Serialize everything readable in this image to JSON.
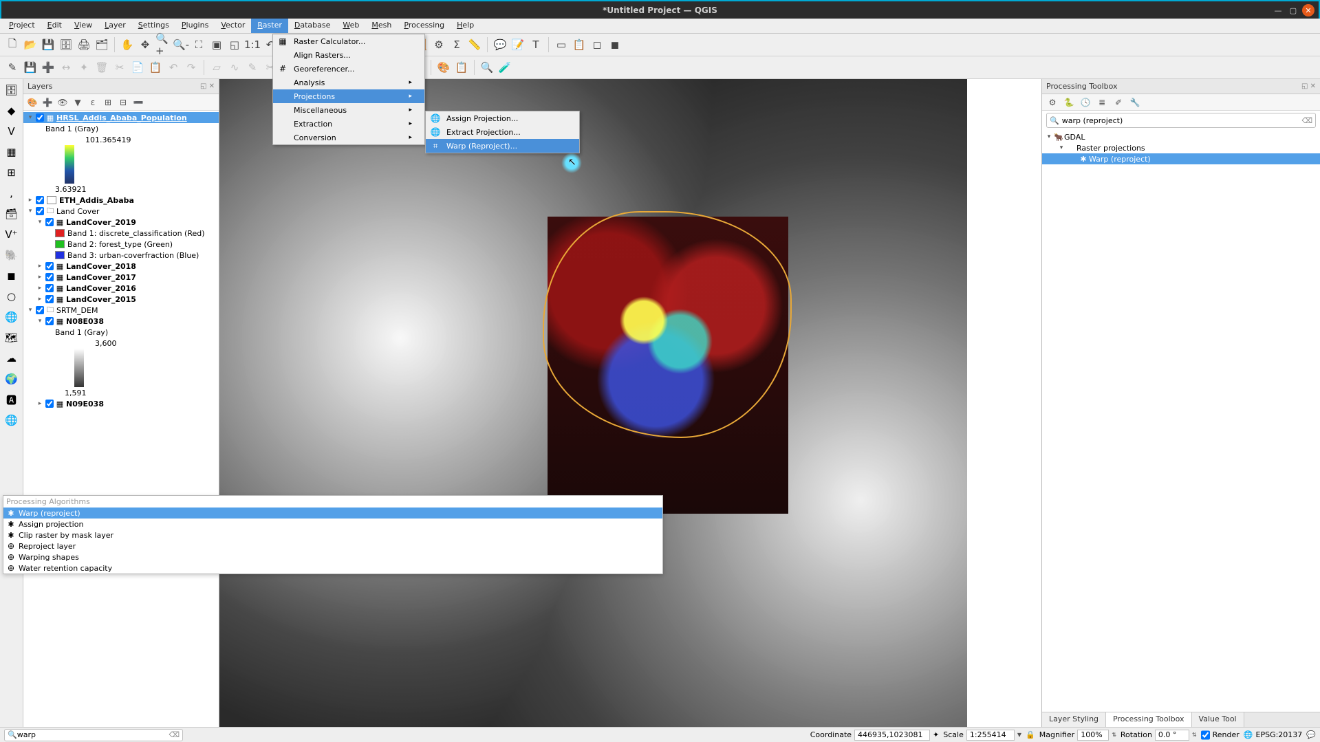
{
  "window": {
    "title": "*Untitled Project — QGIS"
  },
  "menubar": [
    "Project",
    "Edit",
    "View",
    "Layer",
    "Settings",
    "Plugins",
    "Vector",
    "Raster",
    "Database",
    "Web",
    "Mesh",
    "Processing",
    "Help"
  ],
  "menubar_active": "Raster",
  "raster_menu": {
    "items": [
      {
        "label": "Raster Calculator...",
        "icon": "▦"
      },
      {
        "label": "Align Rasters..."
      },
      {
        "label": "Georeferencer...",
        "icon": "#"
      },
      {
        "label": "Analysis",
        "submenu": true
      },
      {
        "label": "Projections",
        "submenu": true,
        "hl": true
      },
      {
        "label": "Miscellaneous",
        "submenu": true
      },
      {
        "label": "Extraction",
        "submenu": true
      },
      {
        "label": "Conversion",
        "submenu": true
      }
    ]
  },
  "proj_submenu": {
    "items": [
      {
        "label": "Assign Projection...",
        "icon": "🌐"
      },
      {
        "label": "Extract Projection...",
        "icon": "🌐"
      },
      {
        "label": "Warp (Reproject)...",
        "icon": "⌗",
        "hl": true
      }
    ]
  },
  "layers_panel": {
    "title": "Layers",
    "tree": [
      {
        "indent": 0,
        "exp": "▾",
        "cb": true,
        "glyph": "▦",
        "label": "HRSL_Addis_Ababa_Population",
        "sel": true,
        "bold": true
      },
      {
        "indent": 1,
        "label": "Band 1 (Gray)"
      },
      {
        "indent": 2,
        "label": "101.365419",
        "gradient": "g1"
      },
      {
        "indent": 2,
        "label": "3.63921"
      },
      {
        "indent": 0,
        "exp": "▸",
        "cb": true,
        "sw": "#ffffff",
        "label": "ETH_Addis_Ababa",
        "bold": true
      },
      {
        "indent": 0,
        "exp": "▾",
        "cb": true,
        "glyph": "🗀",
        "label": "Land Cover"
      },
      {
        "indent": 1,
        "exp": "▾",
        "cb": true,
        "glyph": "▦",
        "label": "LandCover_2019",
        "bold": true
      },
      {
        "indent": 2,
        "sw": "#e02020",
        "label": "Band 1: discrete_classification (Red)"
      },
      {
        "indent": 2,
        "sw": "#20c020",
        "label": "Band 2: forest_type (Green)"
      },
      {
        "indent": 2,
        "sw": "#2030e0",
        "label": "Band 3: urban-coverfraction (Blue)"
      },
      {
        "indent": 1,
        "exp": "▸",
        "cb": true,
        "glyph": "▦",
        "label": "LandCover_2018",
        "bold": true
      },
      {
        "indent": 1,
        "exp": "▸",
        "cb": true,
        "glyph": "▦",
        "label": "LandCover_2017",
        "bold": true
      },
      {
        "indent": 1,
        "exp": "▸",
        "cb": true,
        "glyph": "▦",
        "label": "LandCover_2016",
        "bold": true
      },
      {
        "indent": 1,
        "exp": "▸",
        "cb": true,
        "glyph": "▦",
        "label": "LandCover_2015",
        "bold": true
      },
      {
        "indent": 0,
        "exp": "▾",
        "cb": true,
        "glyph": "🗀",
        "label": "SRTM_DEM"
      },
      {
        "indent": 1,
        "exp": "▾",
        "cb": true,
        "glyph": "▦",
        "label": "N08E038",
        "bold": true
      },
      {
        "indent": 2,
        "label": "Band 1 (Gray)"
      },
      {
        "indent": 3,
        "label": "3,600",
        "gradient": "g2"
      },
      {
        "indent": 3,
        "label": "1,591"
      },
      {
        "indent": 1,
        "exp": "▸",
        "cb": true,
        "glyph": "▦",
        "label": "N09E038",
        "bold": true
      }
    ]
  },
  "processing_popup": {
    "header": "Processing Algorithms",
    "rows": [
      {
        "icon": "✱",
        "label": "Warp (reproject)",
        "sel": true
      },
      {
        "icon": "✱",
        "label": "Assign projection"
      },
      {
        "icon": "✱",
        "label": "Clip raster by mask layer"
      },
      {
        "icon": "🜨",
        "label": "Reproject layer"
      },
      {
        "icon": "🜨",
        "label": "Warping shapes"
      },
      {
        "icon": "🜨",
        "label": "Water retention capacity"
      }
    ]
  },
  "toolbox": {
    "title": "Processing Toolbox",
    "search_value": "warp (reproject)",
    "tree": [
      {
        "indent": 0,
        "exp": "▾",
        "icon": "🐂",
        "label": "GDAL"
      },
      {
        "indent": 1,
        "exp": "▾",
        "label": "Raster projections"
      },
      {
        "indent": 2,
        "icon": "✱",
        "label": "Warp (reproject)",
        "sel": true
      }
    ],
    "tabs": [
      "Layer Styling",
      "Processing Toolbox",
      "Value Tool"
    ],
    "active_tab": "Processing Toolbox"
  },
  "status": {
    "search_value": "warp",
    "coord_label": "Coordinate",
    "coord_value": "446935,1023081",
    "scale_label": "Scale",
    "scale_value": "1:255414",
    "lock_icon": "🔒",
    "magnifier_label": "Magnifier",
    "magnifier_value": "100%",
    "rotation_label": "Rotation",
    "rotation_value": "0.0 °",
    "render_label": "Render",
    "epsg": "EPSG:20137"
  }
}
